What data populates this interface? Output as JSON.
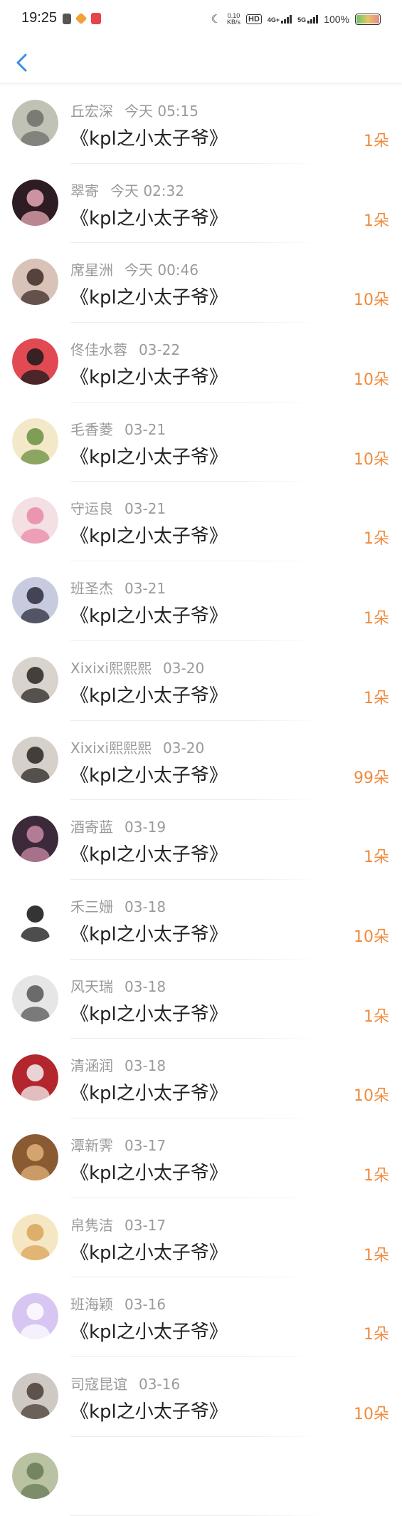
{
  "status_bar": {
    "time": "19:25",
    "speed_value": "0.10",
    "speed_unit": "KB/s",
    "hd": "HD",
    "net1": "4G+",
    "net2": "5G",
    "battery": "100%"
  },
  "colors": {
    "accent": "#3a8ee6",
    "amount": "#f08a3c",
    "name": "#9a9a9a"
  },
  "items": [
    {
      "name": "丘宏深",
      "date": "今天 05:15",
      "title": "《kpl之小太子爷》",
      "amount": "1朵",
      "avatar_bg": "#bfc2b4",
      "avatar_fg": "#6e6e6a"
    },
    {
      "name": "翠寄",
      "date": "今天 02:32",
      "title": "《kpl之小太子爷》",
      "amount": "1朵",
      "avatar_bg": "#2d1c24",
      "avatar_fg": "#e9a9b6"
    },
    {
      "name": "席星洲",
      "date": "今天 00:46",
      "title": "《kpl之小太子爷》",
      "amount": "10朵",
      "avatar_bg": "#d9c3b8",
      "avatar_fg": "#3d2b27"
    },
    {
      "name": "佟佳水蓉",
      "date": "03-22",
      "title": "《kpl之小太子爷》",
      "amount": "10朵",
      "avatar_bg": "#e24a53",
      "avatar_fg": "#1a1a1a"
    },
    {
      "name": "毛香菱",
      "date": "03-21",
      "title": "《kpl之小太子爷》",
      "amount": "10朵",
      "avatar_bg": "#f3e9c9",
      "avatar_fg": "#6a8f3f"
    },
    {
      "name": "守运良",
      "date": "03-21",
      "title": "《kpl之小太子爷》",
      "amount": "1朵",
      "avatar_bg": "#f4dfe3",
      "avatar_fg": "#e98aa8"
    },
    {
      "name": "班圣杰",
      "date": "03-21",
      "title": "《kpl之小太子爷》",
      "amount": "1朵",
      "avatar_bg": "#c8cbe0",
      "avatar_fg": "#2c2c3c"
    },
    {
      "name": "Xixixi熙熙熙",
      "date": "03-20",
      "title": "《kpl之小太子爷》",
      "amount": "1朵",
      "avatar_bg": "#d9d3cd",
      "avatar_fg": "#2a2522"
    },
    {
      "name": "Xixixi熙熙熙",
      "date": "03-20",
      "title": "《kpl之小太子爷》",
      "amount": "99朵",
      "avatar_bg": "#d6d0ca",
      "avatar_fg": "#2a2522"
    },
    {
      "name": "酒寄蓝",
      "date": "03-19",
      "title": "《kpl之小太子爷》",
      "amount": "1朵",
      "avatar_bg": "#3c2a3a",
      "avatar_fg": "#c98aa6"
    },
    {
      "name": "禾三姗",
      "date": "03-18",
      "title": "《kpl之小太子爷》",
      "amount": "10朵",
      "avatar_bg": "#ffffff",
      "avatar_fg": "#111111"
    },
    {
      "name": "风天瑞",
      "date": "03-18",
      "title": "《kpl之小太子爷》",
      "amount": "1朵",
      "avatar_bg": "#e6e6e6",
      "avatar_fg": "#555555"
    },
    {
      "name": "清涵润",
      "date": "03-18",
      "title": "《kpl之小太子爷》",
      "amount": "10朵",
      "avatar_bg": "#b3262d",
      "avatar_fg": "#f2f2f2"
    },
    {
      "name": "潭新霁",
      "date": "03-17",
      "title": "《kpl之小太子爷》",
      "amount": "1朵",
      "avatar_bg": "#8a5a32",
      "avatar_fg": "#e0b27a"
    },
    {
      "name": "帛隽洁",
      "date": "03-17",
      "title": "《kpl之小太子爷》",
      "amount": "1朵",
      "avatar_bg": "#f6e7c4",
      "avatar_fg": "#d9a45a"
    },
    {
      "name": "班海颖",
      "date": "03-16",
      "title": "《kpl之小太子爷》",
      "amount": "1朵",
      "avatar_bg": "#d7c6f2",
      "avatar_fg": "#ffffff"
    },
    {
      "name": "司寇昆谊",
      "date": "03-16",
      "title": "《kpl之小太子爷》",
      "amount": "10朵",
      "avatar_bg": "#cfc9c3",
      "avatar_fg": "#4a3e36"
    },
    {
      "name": "",
      "date": "",
      "title": "",
      "amount": "",
      "avatar_bg": "#b9c3a4",
      "avatar_fg": "#6a7a56"
    }
  ]
}
